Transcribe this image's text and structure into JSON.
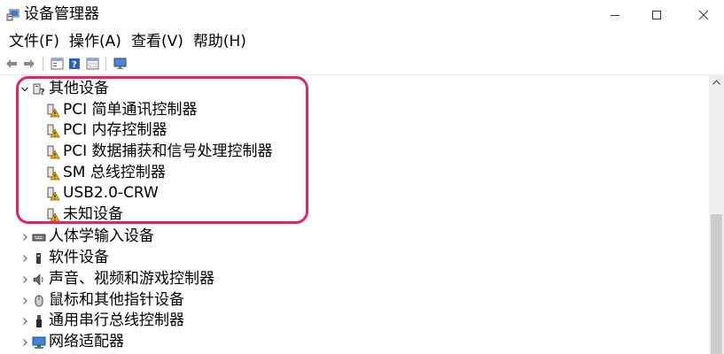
{
  "window": {
    "title": "设备管理器",
    "controls": [
      "minimize",
      "maximize",
      "close"
    ]
  },
  "menu": {
    "items": [
      {
        "label": "文件(F)"
      },
      {
        "label": "操作(A)"
      },
      {
        "label": "查看(V)"
      },
      {
        "label": "帮助(H)"
      }
    ]
  },
  "toolbar": {
    "buttons": [
      "back-icon",
      "forward-icon",
      "properties-icon",
      "help-icon",
      "view-icon",
      "monitor-icon"
    ]
  },
  "tree": {
    "expanded_category": {
      "label": "其他设备",
      "icon": "unknown-device-icon",
      "expanded": true,
      "children": [
        {
          "label": "PCI 简单通讯控制器",
          "icon": "warning-device-icon"
        },
        {
          "label": "PCI 内存控制器",
          "icon": "warning-device-icon"
        },
        {
          "label": "PCI 数据捕获和信号处理控制器",
          "icon": "warning-device-icon"
        },
        {
          "label": "SM 总线控制器",
          "icon": "warning-device-icon"
        },
        {
          "label": "USB2.0-CRW",
          "icon": "warning-device-icon"
        },
        {
          "label": "未知设备",
          "icon": "warning-device-icon"
        }
      ]
    },
    "categories": [
      {
        "label": "人体学输入设备",
        "icon": "keyboard-icon"
      },
      {
        "label": "软件设备",
        "icon": "software-device-icon"
      },
      {
        "label": "声音、视频和游戏控制器",
        "icon": "speaker-icon"
      },
      {
        "label": "鼠标和其他指针设备",
        "icon": "mouse-icon"
      },
      {
        "label": "通用串行总线控制器",
        "icon": "usb-icon"
      },
      {
        "label": "网络适配器",
        "icon": "network-icon"
      }
    ]
  },
  "colors": {
    "highlight": "#e2226b",
    "warning": "#f0b400"
  }
}
